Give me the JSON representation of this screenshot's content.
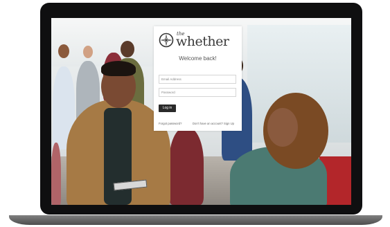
{
  "login": {
    "logo_small": "the",
    "logo_main": "whether",
    "welcome": "Welcome back!",
    "email_placeholder": "Email Address",
    "password_placeholder": "Password",
    "login_button": "Log in",
    "forgot_password": "Forgot password?",
    "signup_text": "Don't have an account? Sign Up"
  }
}
